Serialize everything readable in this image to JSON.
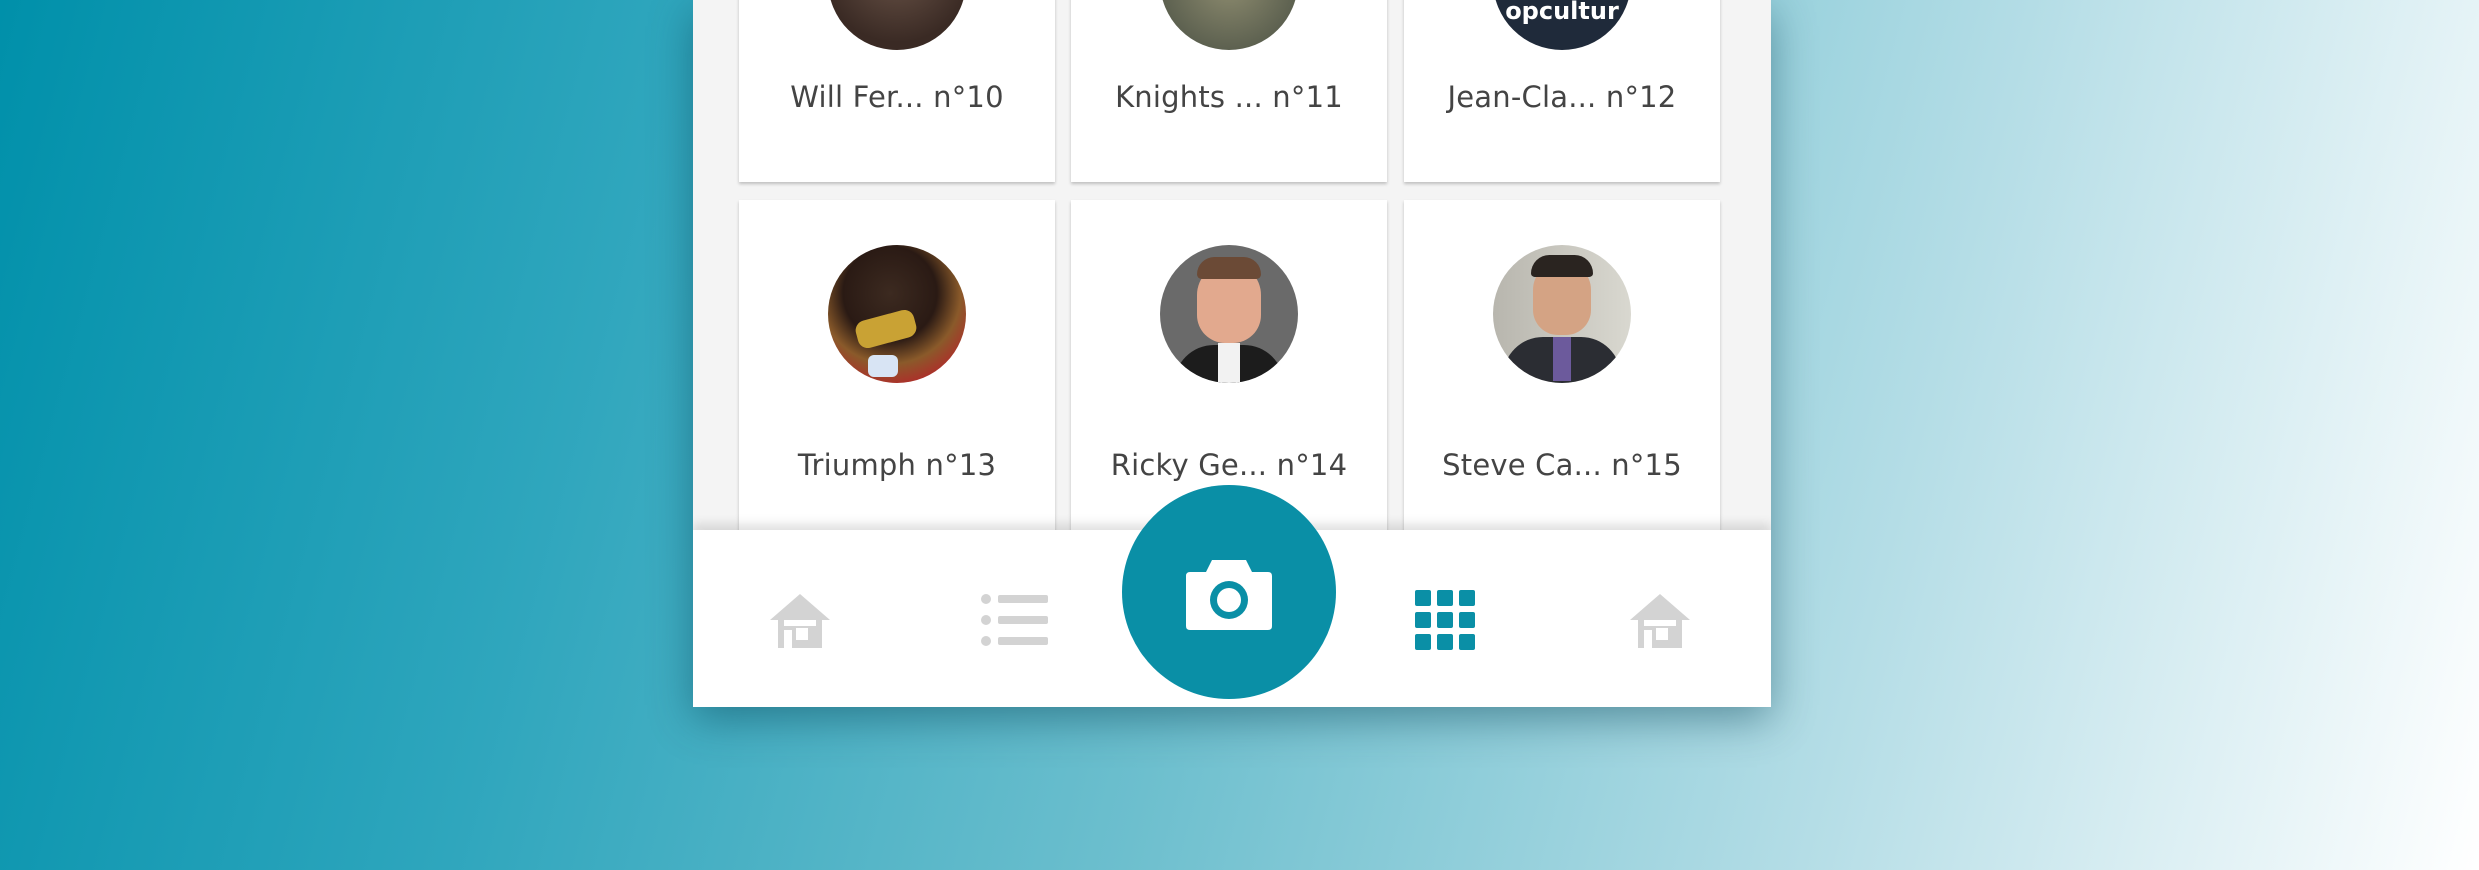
{
  "grid": {
    "rows": [
      [
        {
          "name": "Will Fer... n°10"
        },
        {
          "name": "Knights ... n°11"
        },
        {
          "name": "Jean-Cla... n°12",
          "avatar_text": "opcultur"
        }
      ],
      [
        {
          "name": "Triumph n°13"
        },
        {
          "name": "Ricky Ge... n°14"
        },
        {
          "name": "Steve Ca... n°15"
        }
      ]
    ]
  },
  "tabbar": {
    "items": [
      {
        "icon": "home-icon",
        "active": false
      },
      {
        "icon": "list-icon",
        "active": false
      },
      {
        "icon": "camera-icon",
        "active": true
      },
      {
        "icon": "grid-icon",
        "active": true
      },
      {
        "icon": "home-icon",
        "active": false
      }
    ]
  },
  "colors": {
    "accent": "#0a8fa6",
    "inactive_icon": "#d3d3d3",
    "card_text": "#444444"
  }
}
